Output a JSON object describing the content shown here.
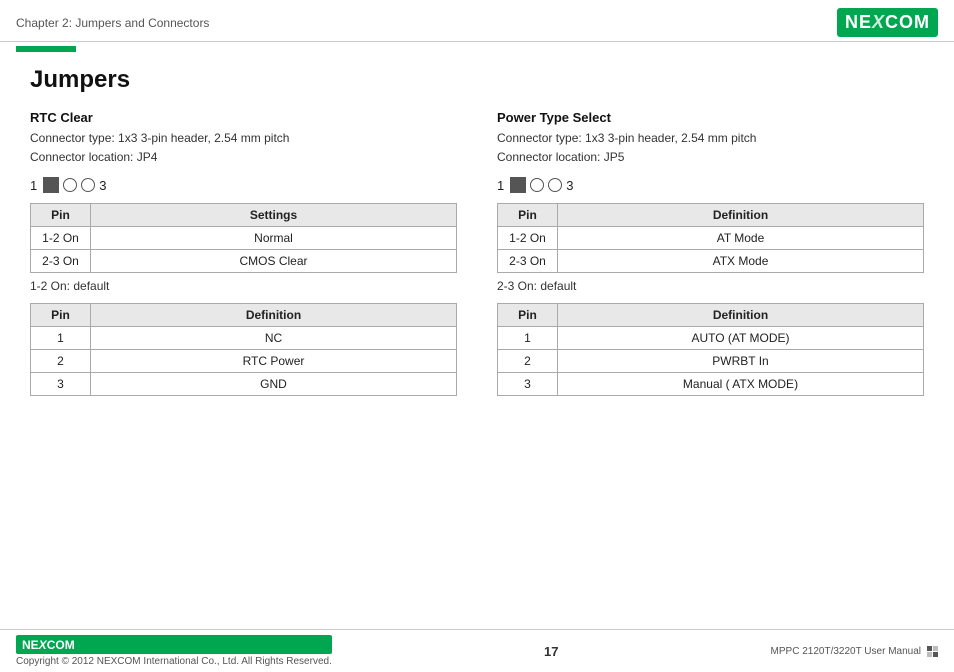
{
  "header": {
    "chapter": "Chapter 2: Jumpers and Connectors",
    "logo": "NE COM"
  },
  "page_title": "Jumpers",
  "left_section": {
    "title": "RTC Clear",
    "connector_type": "Connector type: 1x3 3-pin header, 2.54 mm pitch",
    "connector_location": "Connector location: JP4",
    "diagram_left": "1",
    "diagram_right": "3",
    "table1": {
      "headers": [
        "Pin",
        "Settings"
      ],
      "rows": [
        [
          "1-2 On",
          "Normal"
        ],
        [
          "2-3 On",
          "CMOS Clear"
        ]
      ]
    },
    "default_note1": "1-2 On: default",
    "table2": {
      "headers": [
        "Pin",
        "Definition"
      ],
      "rows": [
        [
          "1",
          "NC"
        ],
        [
          "2",
          "RTC Power"
        ],
        [
          "3",
          "GND"
        ]
      ]
    }
  },
  "right_section": {
    "title": "Power Type Select",
    "connector_type": "Connector type: 1x3 3-pin header, 2.54 mm pitch",
    "connector_location": "Connector location: JP5",
    "diagram_left": "1",
    "diagram_right": "3",
    "table1": {
      "headers": [
        "Pin",
        "Definition"
      ],
      "rows": [
        [
          "1-2 On",
          "AT Mode"
        ],
        [
          "2-3 On",
          "ATX Mode"
        ]
      ]
    },
    "default_note1": "2-3 On: default",
    "table2": {
      "headers": [
        "Pin",
        "Definition"
      ],
      "rows": [
        [
          "1",
          "AUTO (AT MODE)"
        ],
        [
          "2",
          "PWRBT In"
        ],
        [
          "3",
          "Manual ( ATX MODE)"
        ]
      ]
    }
  },
  "footer": {
    "logo": "NE COM",
    "copyright": "Copyright © 2012 NEXCOM International Co., Ltd. All Rights Reserved.",
    "page_number": "17",
    "manual": "MPPC 2120T/3220T User Manual"
  }
}
